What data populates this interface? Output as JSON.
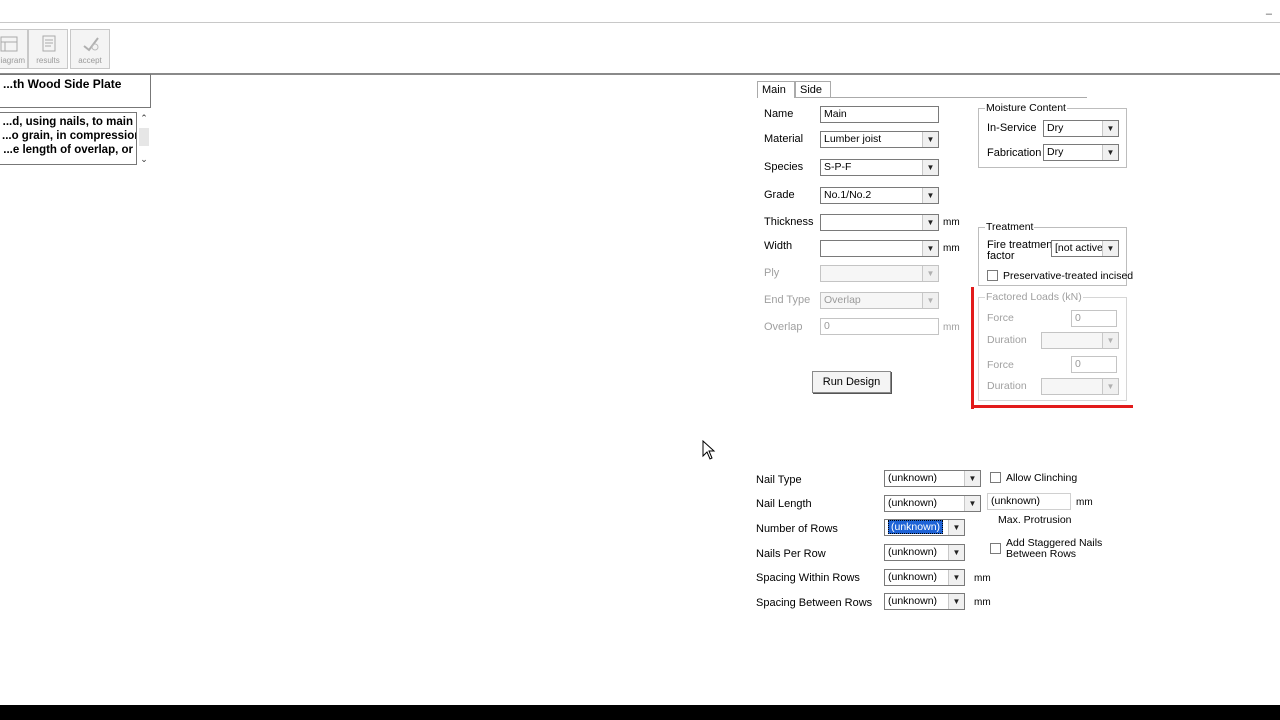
{
  "window": {
    "minimize_glyph": "–"
  },
  "toolbar": {
    "buttons": [
      {
        "label": "diagram",
        "icon": "diagram-icon"
      },
      {
        "label": "results",
        "icon": "results-icon"
      },
      {
        "label": "accept",
        "icon": "accept-icon"
      }
    ]
  },
  "left_panel": {
    "title": "...th Wood Side Plate",
    "description_lines": [
      "...d, using nails, to main",
      "...o grain, in compression",
      "...e length of overlap, or"
    ]
  },
  "tabs": [
    {
      "label": "Main"
    },
    {
      "label": "Side"
    }
  ],
  "form": {
    "name": {
      "label": "Name",
      "value": "Main"
    },
    "material": {
      "label": "Material",
      "value": "Lumber joist"
    },
    "species": {
      "label": "Species",
      "value": "S-P-F"
    },
    "grade": {
      "label": "Grade",
      "value": "No.1/No.2"
    },
    "thickness": {
      "label": "Thickness",
      "value": "",
      "unit": "mm"
    },
    "width": {
      "label": "Width",
      "value": "",
      "unit": "mm"
    },
    "ply": {
      "label": "Ply",
      "value": ""
    },
    "end_type": {
      "label": "End Type",
      "value": "Overlap"
    },
    "overlap": {
      "label": "Overlap",
      "value": "0",
      "unit": "mm"
    },
    "run_design": "Run Design"
  },
  "moisture": {
    "title": "Moisture Content",
    "in_service": {
      "label": "In-Service",
      "value": "Dry"
    },
    "fabrication": {
      "label": "Fabrication",
      "value": "Dry"
    }
  },
  "treatment": {
    "title": "Treatment",
    "fire_label_1": "Fire treatment",
    "fire_label_2": "factor",
    "fire_value": "[not active]",
    "preservative_label": "Preservative-treated incised"
  },
  "loads": {
    "title": "Factored Loads (kN)",
    "force1": {
      "label": "Force",
      "value": "0"
    },
    "duration1": {
      "label": "Duration",
      "value": ""
    },
    "force2": {
      "label": "Force",
      "value": "0"
    },
    "duration2": {
      "label": "Duration",
      "value": ""
    }
  },
  "nails": {
    "type": {
      "label": "Nail Type",
      "value": "(unknown)"
    },
    "length": {
      "label": "Nail Length",
      "value": "(unknown)"
    },
    "rows": {
      "label": "Number of Rows",
      "value": "(unknown)"
    },
    "per_row": {
      "label": "Nails Per Row",
      "value": "(unknown)"
    },
    "spacing_within": {
      "label": "Spacing Within Rows",
      "value": "(unknown)",
      "unit": "mm"
    },
    "spacing_between": {
      "label": "Spacing Between Rows",
      "value": "(unknown)",
      "unit": "mm"
    },
    "allow_clinching": "Allow Clinching",
    "protrusion_value": "(unknown)",
    "protrusion_unit": "mm",
    "protrusion_label": "Max. Protrusion",
    "staggered_1": "Add Staggered Nails",
    "staggered_2": "Between Rows"
  },
  "colors": {
    "highlight": "#e21b1b",
    "selection": "#1e63d6"
  }
}
